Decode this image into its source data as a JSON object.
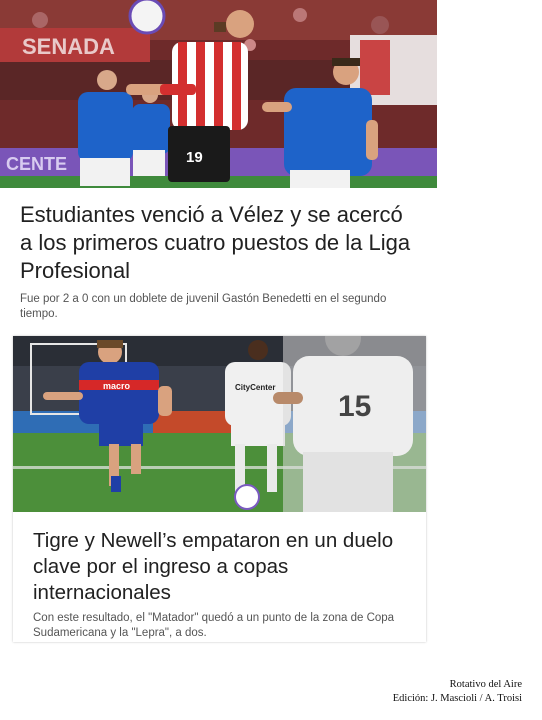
{
  "articles": [
    {
      "image": {
        "description": "Estudiantes player controlling the ball against Vélez players",
        "stadium_banner": "SENADA",
        "board_text": "CENTE",
        "player_number": "19",
        "colors": {
          "estudiantes_red": "#d32f2f",
          "velez_blue": "#1e63c9",
          "pitch": "#3f8a3c",
          "crowd": "#7a2b2b"
        }
      },
      "headline": "Estudiantes venció a Vélez y se acercó a los primeros cuatro puestos de la Liga Profesional",
      "summary": "Fue por 2 a 0 con un doblete de juvenil Gastón Benedetti en el segundo tiempo."
    },
    {
      "image": {
        "description": "Tigre and Newell's players during a match",
        "shirt_sponsor": "macro",
        "shirt_sponsor_2": "CityCenter",
        "player_number": "15",
        "colors": {
          "tigre_blue": "#1f3fa6",
          "tigre_red": "#d62828",
          "newells_white": "#f0f0f0",
          "pitch": "#4c8f3a"
        }
      },
      "headline": "Tigre y Newell’s empataron en un duelo clave por el ingreso a copas internacionales",
      "summary": "Con este resultado, el \"Matador\" quedó a un punto de la zona de Copa Sudamericana y la \"Lepra\", a dos."
    }
  ],
  "credits": {
    "line1": "Rotativo del Aire",
    "line2": "Edición: J. Mascioli / A. Troisi"
  }
}
